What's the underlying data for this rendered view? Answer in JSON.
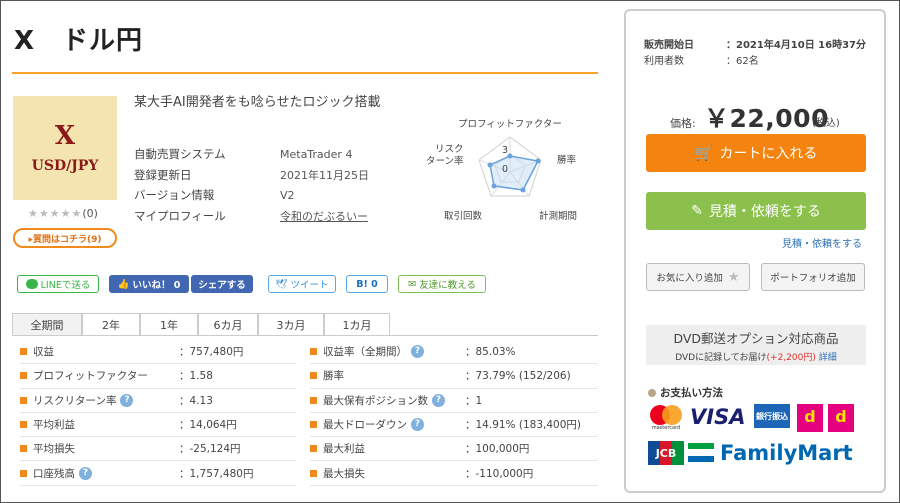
{
  "title": "X　ドル円",
  "product_image": {
    "line1": "X",
    "line2": "USD/JPY"
  },
  "rating": {
    "stars": "★★★★★",
    "count": "(0)"
  },
  "qa_button": "▸質問はコチラ(9)",
  "headline": "某大手AI開発者をも唸らせたロジック搭載",
  "info": [
    {
      "key": "自動売買システム",
      "value": "MetaTrader 4"
    },
    {
      "key": "登録更新日",
      "value": "2021年11月25日"
    },
    {
      "key": "バージョン情報",
      "value": "V2"
    },
    {
      "key": "マイプロフィール",
      "value": "令和のだぶるいー"
    }
  ],
  "radar": {
    "labels": {
      "top": "プロフィットファクター",
      "right": "勝率",
      "bottom_right": "計測期間",
      "bottom_left": "取引回数",
      "left": "リスク\nターン率"
    },
    "tick_outer": "3",
    "tick_inner": "0"
  },
  "share": {
    "line": "LINEで送る",
    "like": "いいね！ 0",
    "fb_share": "シェアする",
    "tweet": "ツイート",
    "hatena": "B! 0",
    "friend": "友達に教える"
  },
  "tabs": [
    "全期間",
    "2年",
    "1年",
    "6カ月",
    "3カ月",
    "1カ月"
  ],
  "stats_left": [
    {
      "key": "収益",
      "value": "：757,480円",
      "help": false
    },
    {
      "key": "プロフィットファクター",
      "value": "：1.58",
      "help": false
    },
    {
      "key": "リスクリターン率",
      "value": "：4.13",
      "help": true
    },
    {
      "key": "平均利益",
      "value": "：14,064円",
      "help": false
    },
    {
      "key": "平均損失",
      "value": "：-25,124円",
      "help": false
    },
    {
      "key": "口座残高",
      "value": "：1,757,480円",
      "help": true
    }
  ],
  "stats_right": [
    {
      "key": "収益率（全期間）",
      "value": "：85.03%",
      "help": true
    },
    {
      "key": "勝率",
      "value": "：73.79% (152/206)",
      "help": false
    },
    {
      "key": "最大保有ポジション数",
      "value": "：1",
      "help": true
    },
    {
      "key": "最大ドローダウン",
      "value": "：14.91% (183,400円)",
      "help": true
    },
    {
      "key": "最大利益",
      "value": "：100,000円",
      "help": false
    },
    {
      "key": "最大損失",
      "value": "：-110,000円",
      "help": false
    }
  ],
  "side": {
    "sale_start_label": "販売開始日",
    "sale_start_value": "：2021年4月10日 16時37分",
    "users_label": "利用者数",
    "users_value": "：62名",
    "price_label": "価格:",
    "price": "￥22,000",
    "tax": "(税込)",
    "cart_button": "カートに入れる",
    "quote_button": "見積・依頼をする",
    "quote_link": "見積・依頼をする",
    "favorite_button": "お気に入り追加",
    "portfolio_button": "ポートフォリオ追加",
    "dvd_title": "DVD郵送オプション対応商品",
    "dvd_sub": "DVDに記録してお届け",
    "dvd_price": "(+2,200円)",
    "dvd_detail": "詳細",
    "payment_heading": "お支払い方法",
    "payment": {
      "mastercard": "mastercard",
      "visa": "VISA",
      "bank": "銀行振込",
      "jcb": "JCB",
      "familymart": "FamilyMart"
    }
  },
  "colors": {
    "accent_orange": "#f4840f",
    "green": "#8cc04c",
    "link_blue": "#2a6fb8"
  }
}
